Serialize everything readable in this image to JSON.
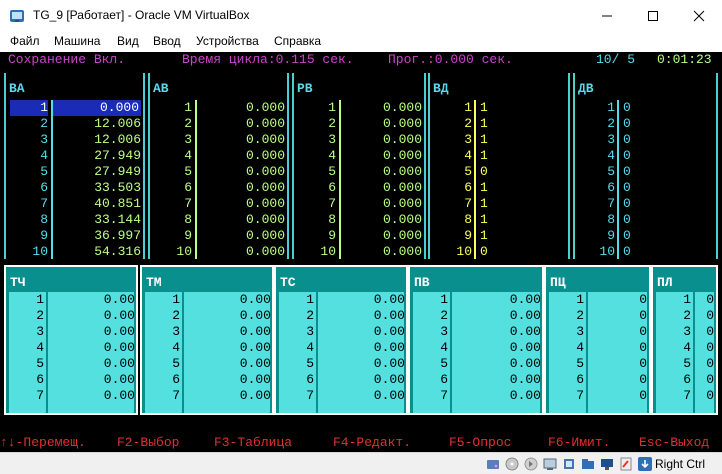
{
  "window": {
    "title": "TG_9 [Работает] - Oracle VM VirtualBox"
  },
  "menu": [
    "Файл",
    "Машина",
    "Вид",
    "Ввод",
    "Устройства",
    "Справка"
  ],
  "console": {
    "status": {
      "save": "Сохранение Вкл.",
      "cycle": "Время цикла:0.115 сек.",
      "prog": "Прог.:0.000 сек.",
      "page": "10/ 5",
      "clock": "0:01:23"
    },
    "top_tables": [
      {
        "title": "ВА",
        "rows": [
          [
            "1",
            "0.000"
          ],
          [
            "2",
            "12.006"
          ],
          [
            "3",
            "12.006"
          ],
          [
            "4",
            "27.949"
          ],
          [
            "5",
            "27.949"
          ],
          [
            "6",
            "33.503"
          ],
          [
            "7",
            "40.851"
          ],
          [
            "8",
            "33.144"
          ],
          [
            "9",
            "36.997"
          ],
          [
            "10",
            "54.316"
          ]
        ]
      },
      {
        "title": "АВ",
        "rows": [
          [
            "1",
            "0.000"
          ],
          [
            "2",
            "0.000"
          ],
          [
            "3",
            "0.000"
          ],
          [
            "4",
            "0.000"
          ],
          [
            "5",
            "0.000"
          ],
          [
            "6",
            "0.000"
          ],
          [
            "7",
            "0.000"
          ],
          [
            "8",
            "0.000"
          ],
          [
            "9",
            "0.000"
          ],
          [
            "10",
            "0.000"
          ]
        ]
      },
      {
        "title": "РВ",
        "rows": [
          [
            "1",
            "0.000"
          ],
          [
            "2",
            "0.000"
          ],
          [
            "3",
            "0.000"
          ],
          [
            "4",
            "0.000"
          ],
          [
            "5",
            "0.000"
          ],
          [
            "6",
            "0.000"
          ],
          [
            "7",
            "0.000"
          ],
          [
            "8",
            "0.000"
          ],
          [
            "9",
            "0.000"
          ],
          [
            "10",
            "0.000"
          ]
        ]
      },
      {
        "title": "ВД",
        "rows": [
          [
            "1",
            "1"
          ],
          [
            "2",
            "1"
          ],
          [
            "3",
            "1"
          ],
          [
            "4",
            "1"
          ],
          [
            "5",
            "0"
          ],
          [
            "6",
            "1"
          ],
          [
            "7",
            "1"
          ],
          [
            "8",
            "1"
          ],
          [
            "9",
            "1"
          ],
          [
            "10",
            "0"
          ]
        ]
      },
      {
        "title": "ДВ",
        "rows": [
          [
            "1",
            "0"
          ],
          [
            "2",
            "0"
          ],
          [
            "3",
            "0"
          ],
          [
            "4",
            "0"
          ],
          [
            "5",
            "0"
          ],
          [
            "6",
            "0"
          ],
          [
            "7",
            "0"
          ],
          [
            "8",
            "0"
          ],
          [
            "9",
            "0"
          ],
          [
            "10",
            "0"
          ]
        ]
      }
    ],
    "bottom_tables": [
      {
        "title": "ТЧ",
        "rows": [
          [
            "1",
            "0.00"
          ],
          [
            "2",
            "0.00"
          ],
          [
            "3",
            "0.00"
          ],
          [
            "4",
            "0.00"
          ],
          [
            "5",
            "0.00"
          ],
          [
            "6",
            "0.00"
          ],
          [
            "7",
            "0.00"
          ]
        ]
      },
      {
        "title": "ТМ",
        "rows": [
          [
            "1",
            "0.00"
          ],
          [
            "2",
            "0.00"
          ],
          [
            "3",
            "0.00"
          ],
          [
            "4",
            "0.00"
          ],
          [
            "5",
            "0.00"
          ],
          [
            "6",
            "0.00"
          ],
          [
            "7",
            "0.00"
          ]
        ]
      },
      {
        "title": "ТС",
        "rows": [
          [
            "1",
            "0.00"
          ],
          [
            "2",
            "0.00"
          ],
          [
            "3",
            "0.00"
          ],
          [
            "4",
            "0.00"
          ],
          [
            "5",
            "0.00"
          ],
          [
            "6",
            "0.00"
          ],
          [
            "7",
            "0.00"
          ]
        ]
      },
      {
        "title": "ПВ",
        "rows": [
          [
            "1",
            "0.00"
          ],
          [
            "2",
            "0.00"
          ],
          [
            "3",
            "0.00"
          ],
          [
            "4",
            "0.00"
          ],
          [
            "5",
            "0.00"
          ],
          [
            "6",
            "0.00"
          ],
          [
            "7",
            "0.00"
          ]
        ]
      },
      {
        "title": "ПЦ",
        "rows": [
          [
            "1",
            "0"
          ],
          [
            "2",
            "0"
          ],
          [
            "3",
            "0"
          ],
          [
            "4",
            "0"
          ],
          [
            "5",
            "0"
          ],
          [
            "6",
            "0"
          ],
          [
            "7",
            "0"
          ]
        ]
      },
      {
        "title": "ПЛ",
        "rows": [
          [
            "1",
            "0"
          ],
          [
            "2",
            "0"
          ],
          [
            "3",
            "0"
          ],
          [
            "4",
            "0"
          ],
          [
            "5",
            "0"
          ],
          [
            "6",
            "0"
          ],
          [
            "7",
            "0"
          ]
        ]
      }
    ],
    "hotkeys": [
      {
        "key": "↑↓",
        "label": "-Перемещ."
      },
      {
        "key": "F2",
        "label": "-Выбор"
      },
      {
        "key": "F3",
        "label": "-Таблица"
      },
      {
        "key": "F4",
        "label": "-Редакт."
      },
      {
        "key": "F5",
        "label": "-Опрос"
      },
      {
        "key": "F6",
        "label": "-Имит."
      },
      {
        "key": "Esc",
        "label": "-Выход"
      }
    ]
  },
  "statusbar": {
    "host_key": "Right Ctrl"
  },
  "colors": {
    "magenta": "#cc44cc",
    "cyan": "#55ddee",
    "green": "#bbff88",
    "yellow": "#ffff55",
    "red": "#e03030",
    "teal": "#0a8f8f",
    "light_cyan": "#55e0e0",
    "selection": "#1a2bb5"
  }
}
